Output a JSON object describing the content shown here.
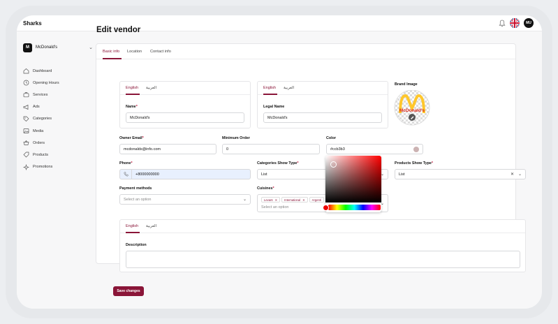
{
  "app": {
    "brand": "Sharks",
    "avatar_initials": "MU"
  },
  "sidebar": {
    "vendor": {
      "logo": "M",
      "name": "McDonald's"
    },
    "items": [
      {
        "label": "Dashboard",
        "icon": "home-icon"
      },
      {
        "label": "Opening Hours",
        "icon": "clock-icon"
      },
      {
        "label": "Services",
        "icon": "briefcase-icon"
      },
      {
        "label": "Ads",
        "icon": "megaphone-icon"
      },
      {
        "label": "Categories",
        "icon": "tag-icon"
      },
      {
        "label": "Media",
        "icon": "image-icon"
      },
      {
        "label": "Orders",
        "icon": "basket-icon"
      },
      {
        "label": "Products",
        "icon": "label-icon"
      },
      {
        "label": "Promotions",
        "icon": "sparkle-icon"
      }
    ]
  },
  "page": {
    "title": "Edit vendor"
  },
  "tabs": [
    "Basic info",
    "Location",
    "Contact info"
  ],
  "lang": {
    "en": "English",
    "ar": "العربية"
  },
  "form": {
    "name_label": "Name",
    "name_value": "McDonald's",
    "legal_label": "Legal Name",
    "legal_value": "McDonald's",
    "brand_image_label": "Brand Image",
    "brand_logo_text": "McDonald's",
    "owner_email_label": "Owner Email",
    "owner_email_value": "mcdonalds@info.com",
    "min_order_label": "Minimum Order",
    "min_order_value": "0",
    "color_label": "Color",
    "color_value": "#ccb3b3",
    "phone_label": "Phone",
    "phone_value": "+8000000000",
    "cat_show_label": "Categories Show Type",
    "cat_show_value": "List",
    "prod_show_label": "Products Show Type",
    "prod_show_value": "List",
    "payment_label": "Payment methods",
    "payment_placeholder": "Select an option",
    "cuisines_label": "Cuisines",
    "cuisines_placeholder": "Select an option",
    "cuisines_chips": [
      "Levant",
      "International",
      "Argenti"
    ],
    "description_label": "Description"
  },
  "actions": {
    "save": "Save changes"
  },
  "colors": {
    "accent": "#8a1538",
    "swatch": "#ccb3b3"
  }
}
